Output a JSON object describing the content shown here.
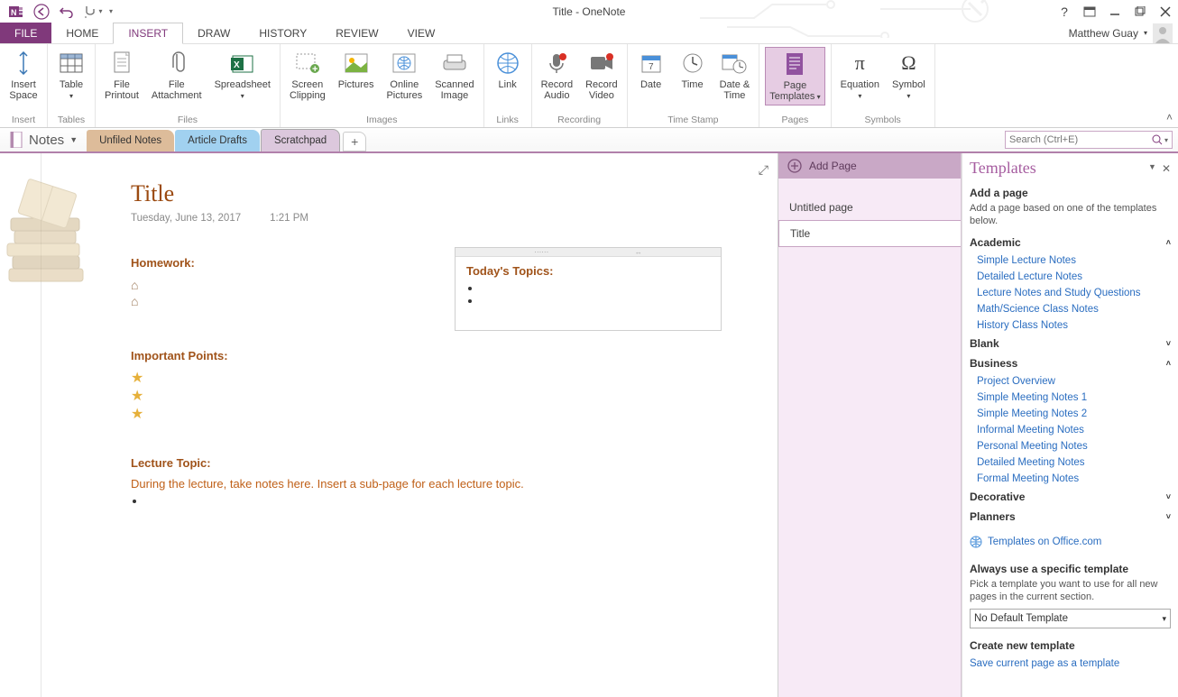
{
  "window": {
    "title": "Title - OneNote"
  },
  "user": {
    "name": "Matthew Guay"
  },
  "ribbon_tabs": {
    "file": "FILE",
    "home": "HOME",
    "insert": "INSERT",
    "draw": "DRAW",
    "history": "HISTORY",
    "review": "REVIEW",
    "view": "VIEW"
  },
  "ribbon": {
    "insert_space": "Insert\nSpace",
    "table": "Table",
    "file_printout": "File\nPrintout",
    "file_attachment": "File\nAttachment",
    "spreadsheet": "Spreadsheet",
    "screen_clipping": "Screen\nClipping",
    "pictures": "Pictures",
    "online_pictures": "Online\nPictures",
    "scanned_image": "Scanned\nImage",
    "link": "Link",
    "record_audio": "Record\nAudio",
    "record_video": "Record\nVideo",
    "date": "Date",
    "time": "Time",
    "date_time": "Date &\nTime",
    "page_templates": "Page\nTemplates",
    "equation": "Equation",
    "symbol": "Symbol",
    "groups": {
      "insert": "Insert",
      "tables": "Tables",
      "files": "Files",
      "images": "Images",
      "links": "Links",
      "recording": "Recording",
      "time_stamp": "Time Stamp",
      "pages": "Pages",
      "symbols": "Symbols"
    }
  },
  "notebook": {
    "name": "Notes"
  },
  "sections": {
    "unfiled": "Unfiled Notes",
    "drafts": "Article Drafts",
    "scratch": "Scratchpad"
  },
  "search": {
    "placeholder": "Search (Ctrl+E)"
  },
  "page": {
    "title": "Title",
    "date": "Tuesday, June 13, 2017",
    "time": "1:21 PM",
    "homework_heading": "Homework:",
    "important_heading": "Important Points:",
    "lecture_heading": "Lecture Topic:",
    "lecture_desc": "During the lecture, take notes here.  Insert a sub-page for each lecture topic.",
    "topics_heading": "Today's Topics:"
  },
  "pagelist": {
    "add": "Add Page",
    "items": [
      "Untitled page",
      "Title"
    ]
  },
  "templates": {
    "title": "Templates",
    "add_heading": "Add a page",
    "add_desc": "Add a page based on one of the templates below.",
    "categories": {
      "academic": "Academic",
      "blank": "Blank",
      "business": "Business",
      "decorative": "Decorative",
      "planners": "Planners"
    },
    "academic_items": [
      "Simple Lecture Notes",
      "Detailed Lecture Notes",
      "Lecture Notes and Study Questions",
      "Math/Science Class Notes",
      "History Class Notes"
    ],
    "business_items": [
      "Project Overview",
      "Simple Meeting Notes 1",
      "Simple Meeting Notes 2",
      "Informal Meeting Notes",
      "Personal Meeting Notes",
      "Detailed Meeting Notes",
      "Formal Meeting Notes"
    ],
    "office_link": "Templates on Office.com",
    "always_heading": "Always use a specific template",
    "always_desc": "Pick a template you want to use for all new pages in the current section.",
    "default_dropdown": "No Default Template",
    "create_heading": "Create new template",
    "save_link": "Save current page as a template"
  }
}
